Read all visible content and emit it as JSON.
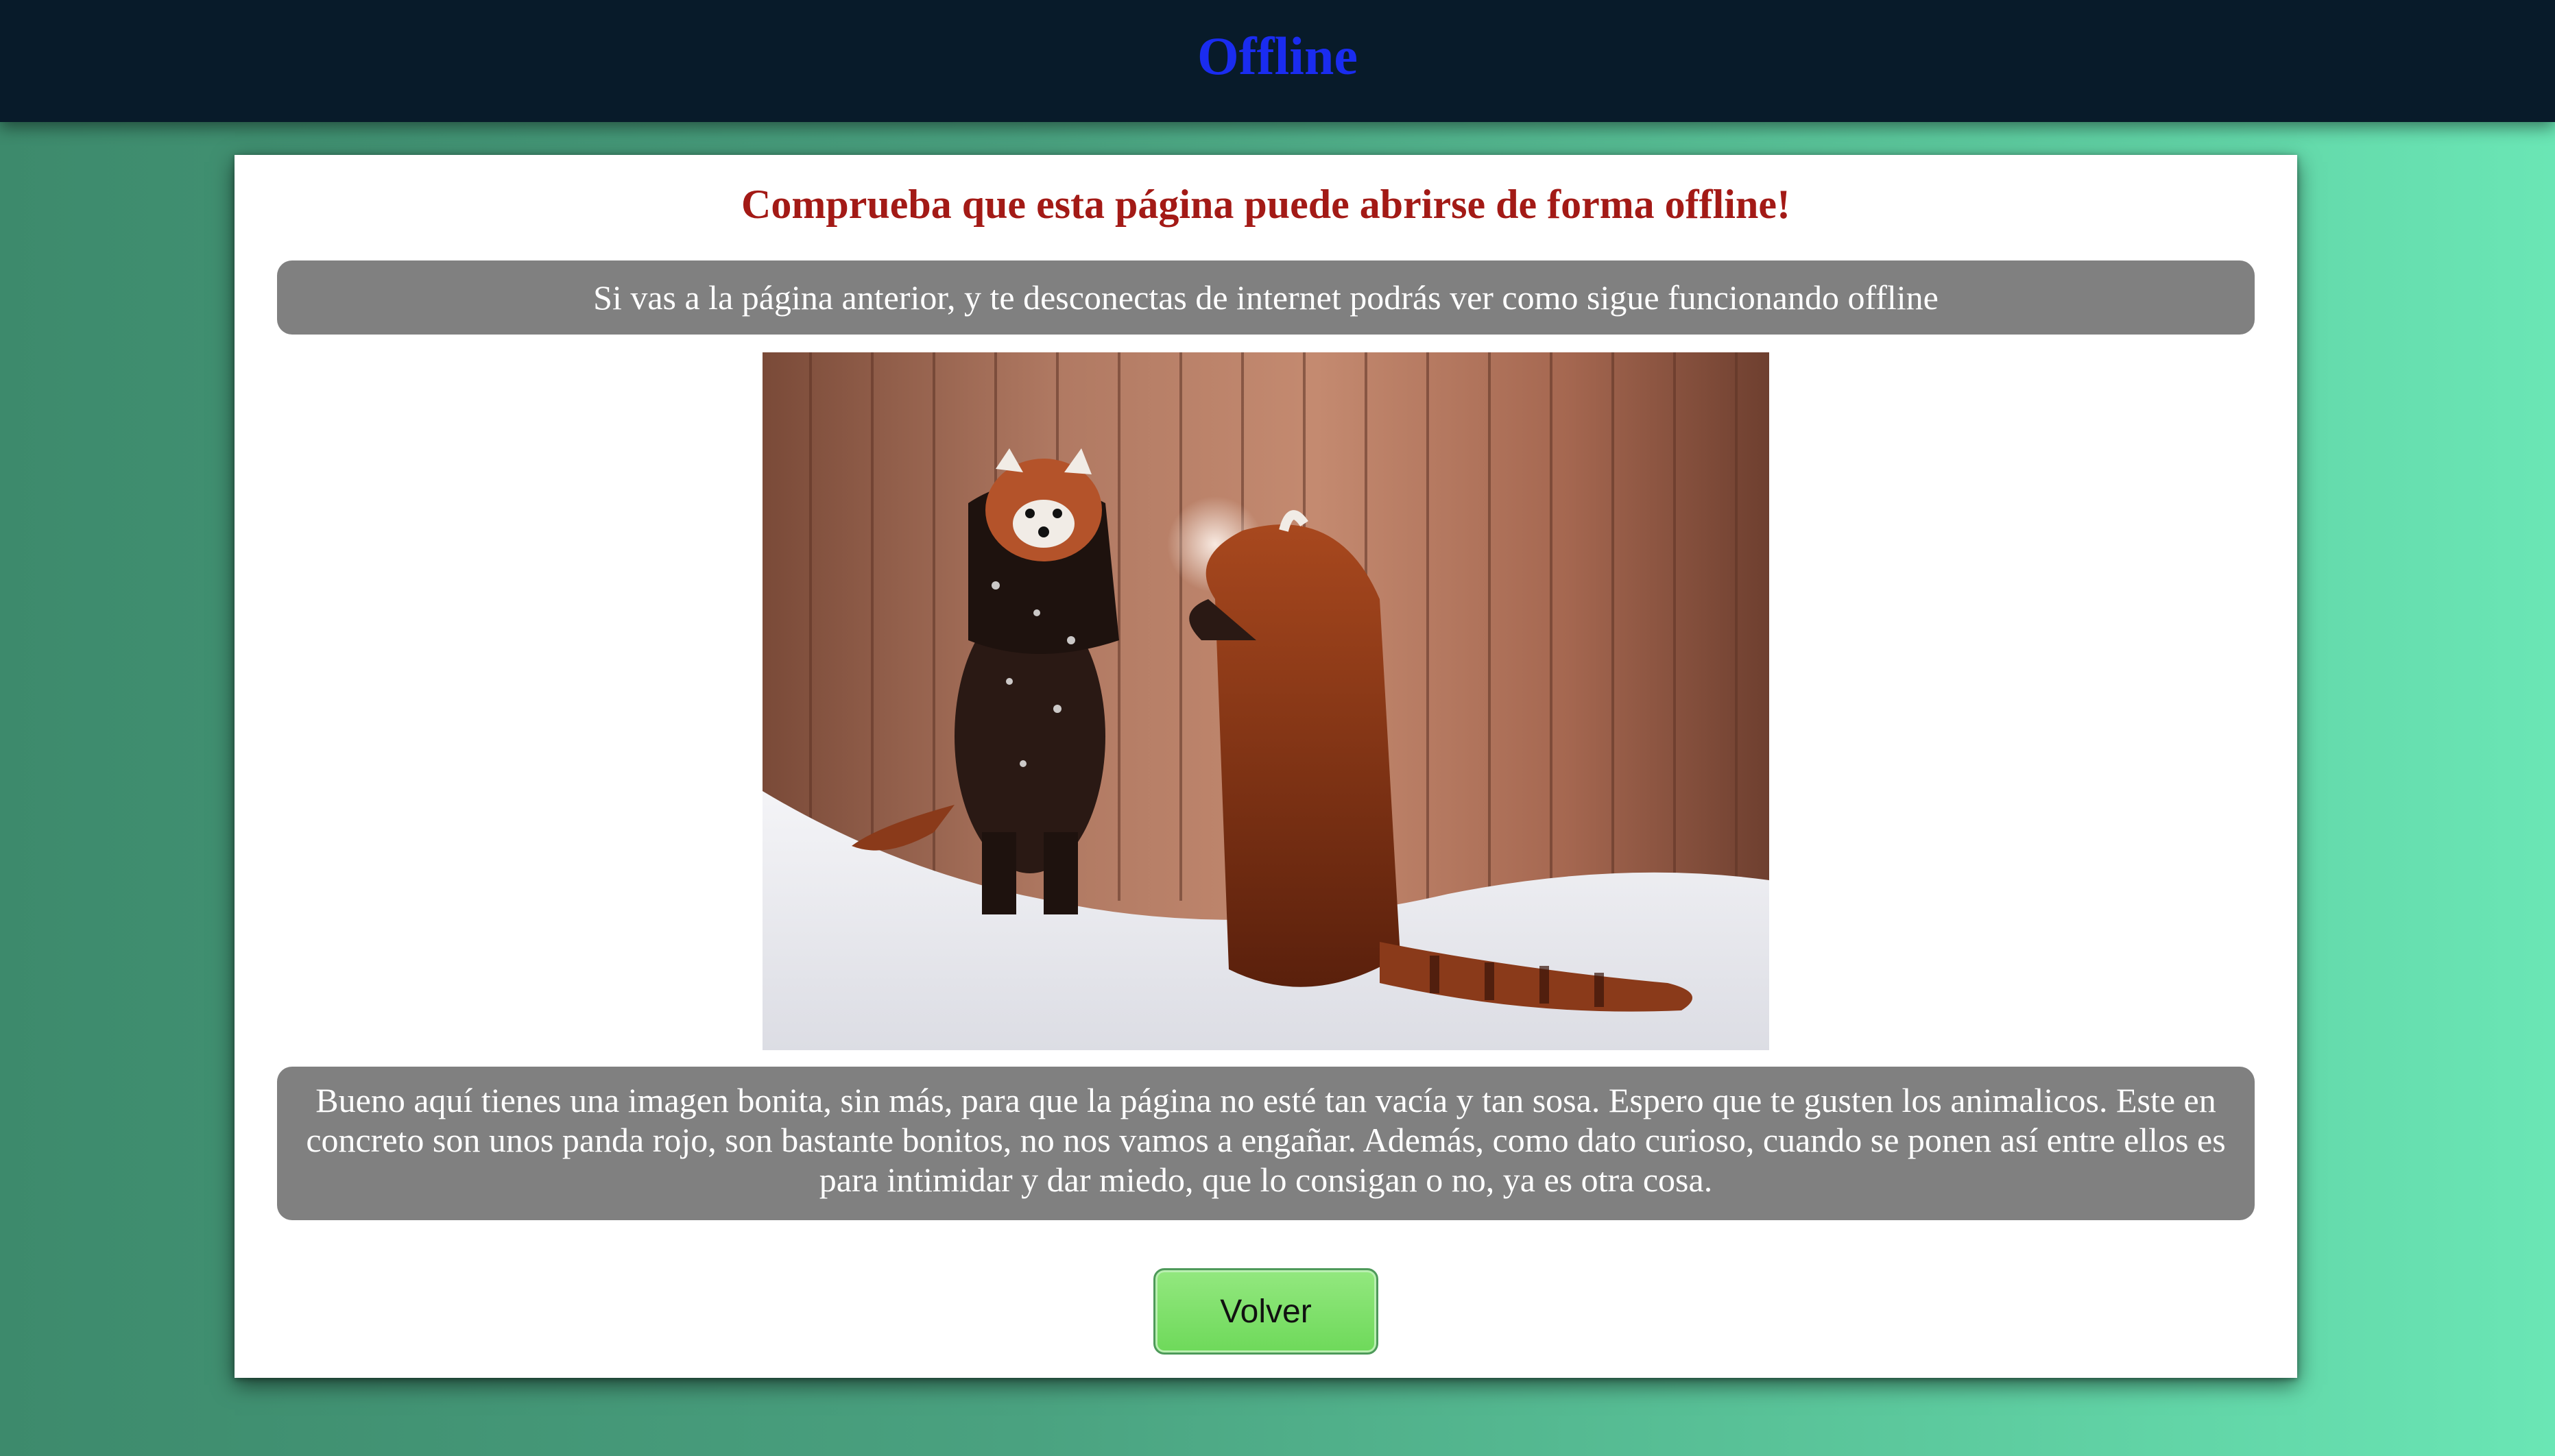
{
  "header": {
    "title": "Offline"
  },
  "main": {
    "heading": "Comprueba que esta página puede abrirse de forma offline!",
    "notice": "Si vas a la página anterior, y te desconectas de internet podrás ver como sigue funcionando offline",
    "image_subject": "two red pandas standing on hind legs in snow in front of a wooden fence",
    "description": "Bueno aquí tienes una imagen bonita, sin más, para que la página no esté tan vacía y tan sosa. Espero que te gusten los animalicos. Este en concreto son unos panda rojo, son bastante bonitos, no nos vamos a engañar. Además, como dato curioso, cuando se ponen así entre ellos es para intimidar y dar miedo, que lo consigan o no, ya es otra cosa.",
    "back_button_label": "Volver"
  },
  "colors": {
    "header_bg": "#081b2a",
    "header_title": "#1a2cf0",
    "heading": "#a31a16",
    "info_box_bg": "#808080",
    "button_bg": "#6ed95a"
  }
}
